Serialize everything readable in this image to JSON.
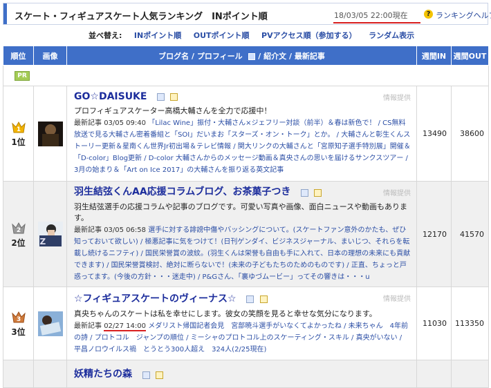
{
  "header": {
    "title": "スケート・フィギュアスケート人気ランキング　INポイント順",
    "timestamp": "18/03/05 22:00現在",
    "help_label": "ランキングヘルプ",
    "help_icon": "question-icon"
  },
  "sort": {
    "label": "並べ替え:",
    "options": [
      "INポイント順",
      "OUTポイント順",
      "PVアクセス順（参加する）",
      "ランダム表示"
    ]
  },
  "table": {
    "headers": [
      "順位",
      "画像",
      "ブログ名 / プロフィール",
      "紹介文 / 最新記事",
      "週間IN",
      "週間OUT"
    ],
    "pr_label": "PR",
    "info_label": "情報提供",
    "latest_label": "最新記事",
    "rows": [
      {
        "rank": "1位",
        "title": "GO☆DAISUKE",
        "desc": "プロフィギュアスケーター高橋大輔さんを全力で応援中！",
        "date": "03/05 09:40",
        "entries": "「Lilac Wine」振付・大輔さん×ジェフリー対談（前半）＆春は新色で！ / CS無料放送で見る大輔さん密着番組と「SOI」だいまお「スターズ・オン・トーク」とか。 / 大輔さんと彰生くんストーリー更新＆星南くん世界Jr初出場＆テレビ情報 / 関大リンクの大輔さんと「宮原知子選手特別展」開催＆「D-color」Blog更新 / D-color 大輔さんからのメッセージ動画＆真央さんの思いを届けるサンクスツアー / 3月の始まり＆「Art on Ice 2017」の大輔さんを振り返る英文記事",
        "in": "13490",
        "out": "38600"
      },
      {
        "rank": "2位",
        "title": "羽生結弦くんAA応援コラムブログ、お茶菓子つき",
        "desc": "羽生結弦選手の応援コラムや記事のブログです。可愛い写真や画像、面白ニュースや動画もあります。",
        "date": "03/05 06:58",
        "entries": "選手に対する誹謗中傷やバッシングについて。(スケートファン意外のかたも、ぜひ知っておいて欲しい) / 極悪記事に気をつけて！(日刊ゲンダイ、ビジネスジャーナル、まいじつ、それらを転載し続けるニフティ) / 国民栄誉賞の波紋。(羽生くんは栄誉も自由も手に入れて、日本の理想の未来にも貢献できます) / 国民栄誉賞検討、絶対に断らないで！(未来の子どもたちのためのものです) / 正直、ちょっと戸惑ってます。(今後の方針・・・迷走中) / P&Gさん、「裏ゆづムービー」ってその響きは・・・u",
        "in": "12170",
        "out": "41570"
      },
      {
        "rank": "3位",
        "title": "☆フィギュアスケートのヴィーナス☆",
        "desc": "真央ちゃんのスケートは私を幸せにします。彼女の笑顔を見ると幸せな気分になります。",
        "date": "02/27 14:00",
        "entries": "メダリスト帰国記者会見　宮部暁斗選手がいなくてよかったね / 未来ちゃん　4年前の詩 / プロトコル　ジャンプの順位 / ミーシャのプロトコル上のスケーティング・スキル / 真央がいない / 平昌ノロウイルス禍　とうとう300人超え　324人(2/25現在)",
        "in": "11030",
        "out": "113350"
      },
      {
        "rank": "",
        "title": "妖精たちの森",
        "desc": "",
        "date": "",
        "entries": "",
        "in": "",
        "out": ""
      }
    ]
  },
  "colors": {
    "header_blue": "#3f6fc8",
    "link_blue": "#1c2d9c",
    "underline_red": "#d81e1e",
    "gold": "#f3b400",
    "silver": "#9a9a9a",
    "bronze": "#d07a3a"
  }
}
